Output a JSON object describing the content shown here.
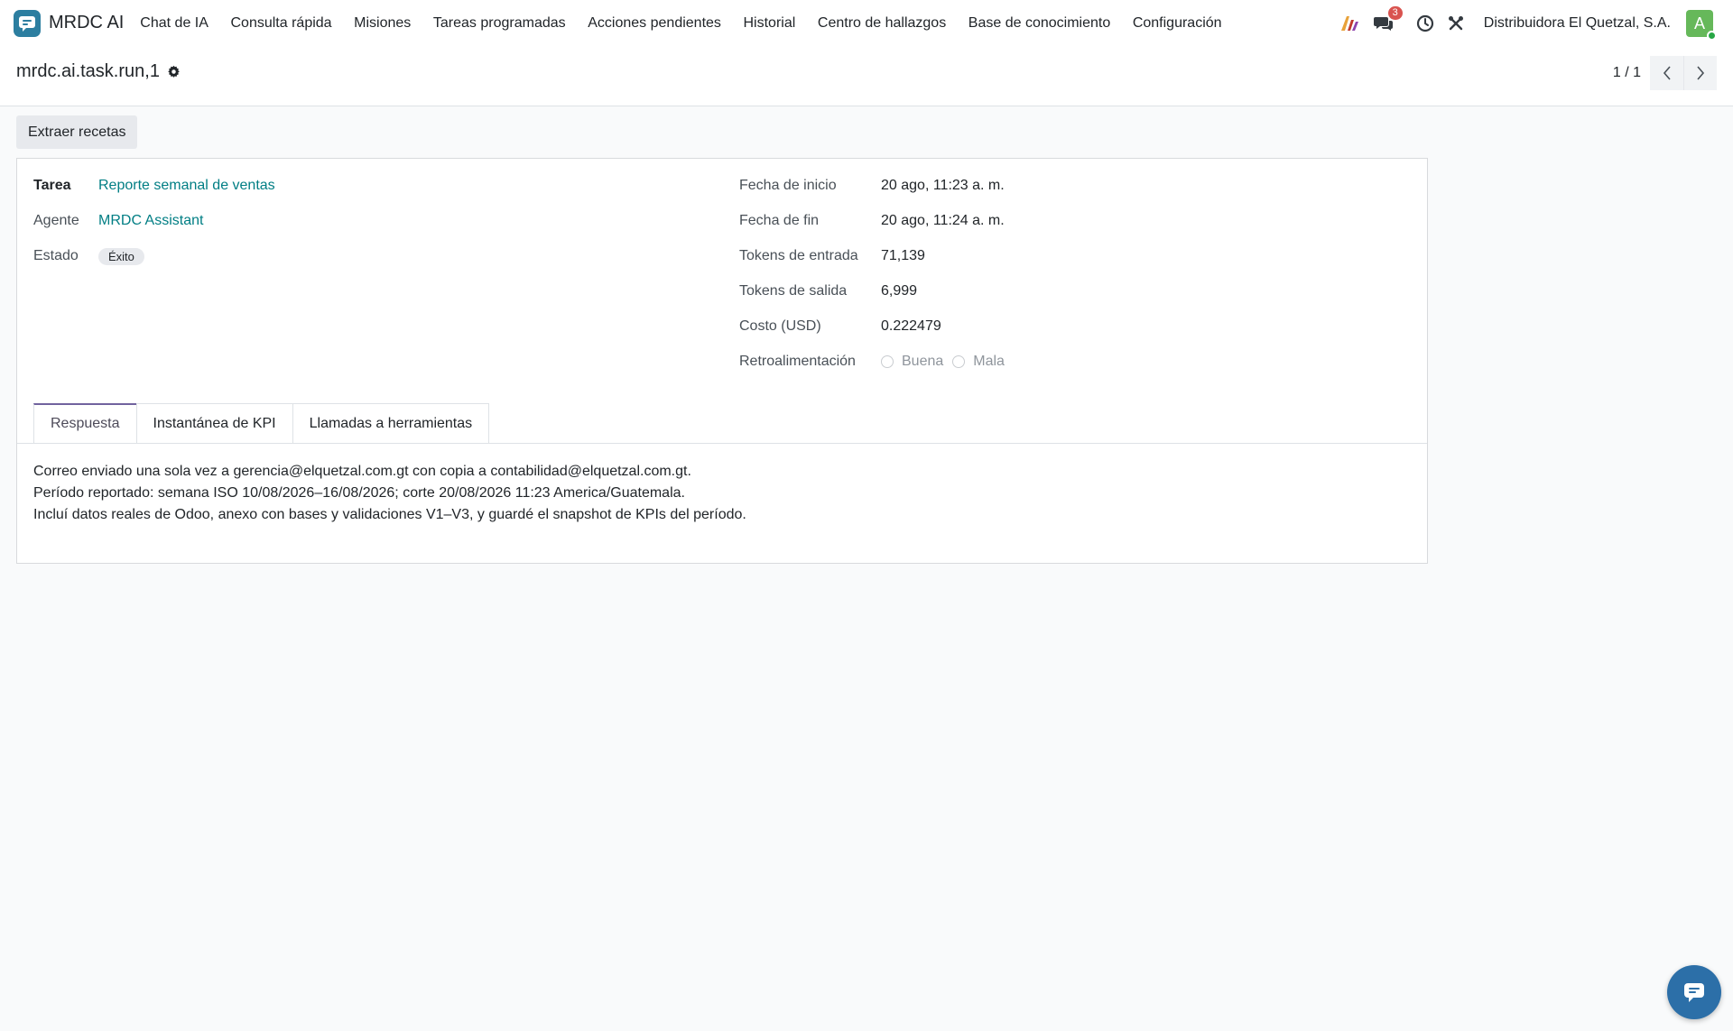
{
  "app": {
    "name": "MRDC AI"
  },
  "nav": {
    "items": [
      "Chat de IA",
      "Consulta rápida",
      "Misiones",
      "Tareas programadas",
      "Acciones pendientes",
      "Historial",
      "Centro de hallazgos",
      "Base de conocimiento",
      "Configuración"
    ]
  },
  "systray": {
    "messages_count": "3",
    "company": "Distribuidora El Quetzal, S.A.",
    "avatar_letter": "A"
  },
  "breadcrumb": {
    "record": "mrdc.ai.task.run,1"
  },
  "pager": {
    "value": "1 / 1"
  },
  "actions": {
    "extract_label": "Extraer recetas"
  },
  "form": {
    "left": {
      "task_label": "Tarea",
      "task_value": "Reporte semanal de ventas",
      "agent_label": "Agente",
      "agent_value": "MRDC Assistant",
      "status_label": "Estado",
      "status_value": "Éxito"
    },
    "right": {
      "start_label": "Fecha de inicio",
      "start_value": "20 ago, 11:23 a. m.",
      "end_label": "Fecha de fin",
      "end_value": "20 ago, 11:24 a. m.",
      "tokens_in_label": "Tokens de entrada",
      "tokens_in_value": "71,139",
      "tokens_out_label": "Tokens de salida",
      "tokens_out_value": "6,999",
      "cost_label": "Costo (USD)",
      "cost_value": "0.222479",
      "feedback_label": "Retroalimentación",
      "feedback_good": "Buena",
      "feedback_bad": "Mala"
    }
  },
  "tabs": [
    {
      "label": "Respuesta",
      "active": true
    },
    {
      "label": "Instantánea de KPI",
      "active": false
    },
    {
      "label": "Llamadas a herramientas",
      "active": false
    }
  ],
  "response": {
    "lines": [
      "Correo enviado una sola vez a gerencia@elquetzal.com.gt con copia a contabilidad@elquetzal.com.gt.",
      "Período reportado: semana ISO 10/08/2026–16/08/2026; corte 20/08/2026 11:23 America/Guatemala.",
      "Incluí datos reales de Odoo, anexo con bases y validaciones V1–V3, y guardé el snapshot de KPIs del período."
    ]
  },
  "colors": {
    "link": "#017e84",
    "active_tab": "#71639e",
    "app_icon": "#2c7ea0",
    "avatar": "#66b85a",
    "badge": "#d9534f"
  },
  "icons": [
    "chat-bubble-icon",
    "ai-logo-icon",
    "messages-icon",
    "clock-icon",
    "tools-icon",
    "gear-icon",
    "chevron-left-icon",
    "chevron-right-icon",
    "chat-fab-icon"
  ]
}
